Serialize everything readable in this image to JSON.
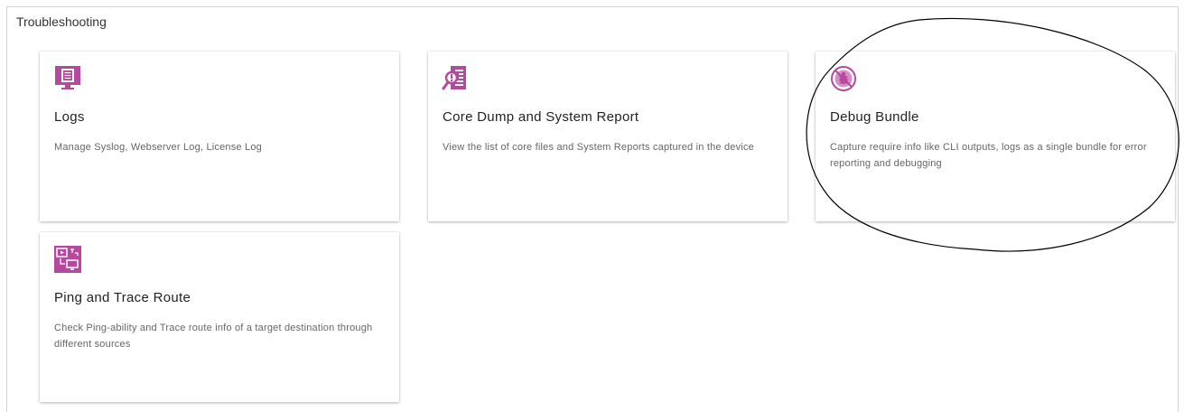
{
  "section": {
    "title": "Troubleshooting"
  },
  "cards": [
    {
      "title": "Logs",
      "description": "Manage Syslog, Webserver Log, License Log",
      "icon": "monitor-log-icon"
    },
    {
      "title": "Core Dump and System Report",
      "description": "View the list of core files and System Reports captured in the device",
      "icon": "report-search-icon"
    },
    {
      "title": "Debug Bundle",
      "description": "Capture require info like CLI outputs, logs as a single bundle for error reporting and debugging",
      "icon": "no-bug-icon"
    },
    {
      "title": "Ping and Trace Route",
      "description": "Check Ping-ability and Trace route info of a target destination through different sources",
      "icon": "network-trace-icon"
    }
  ],
  "colors": {
    "accent": "#b5499e",
    "annotation": "#000000"
  }
}
